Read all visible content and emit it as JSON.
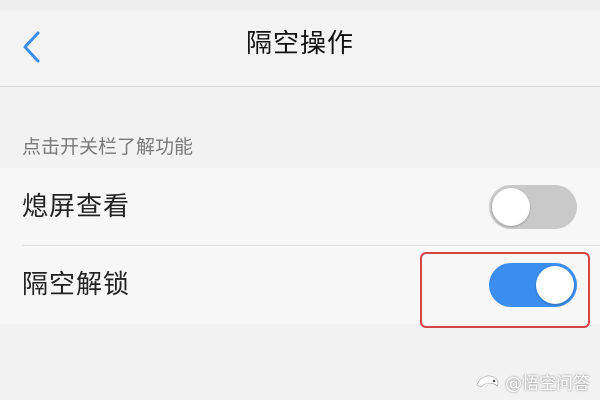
{
  "header": {
    "title": "隔空操作",
    "back_icon": "chevron-left-icon"
  },
  "section": {
    "hint": "点击开关栏了解功能"
  },
  "settings": {
    "items": [
      {
        "label": "熄屏查看",
        "toggle_state": "off"
      },
      {
        "label": "隔空解锁",
        "toggle_state": "on"
      }
    ]
  },
  "watermark": {
    "text": "@悟空问答"
  },
  "colors": {
    "accent": "#3b8ef0",
    "toggle_off": "#c9c9c9",
    "highlight": "#d64545",
    "back_icon": "#3b8ef0"
  }
}
